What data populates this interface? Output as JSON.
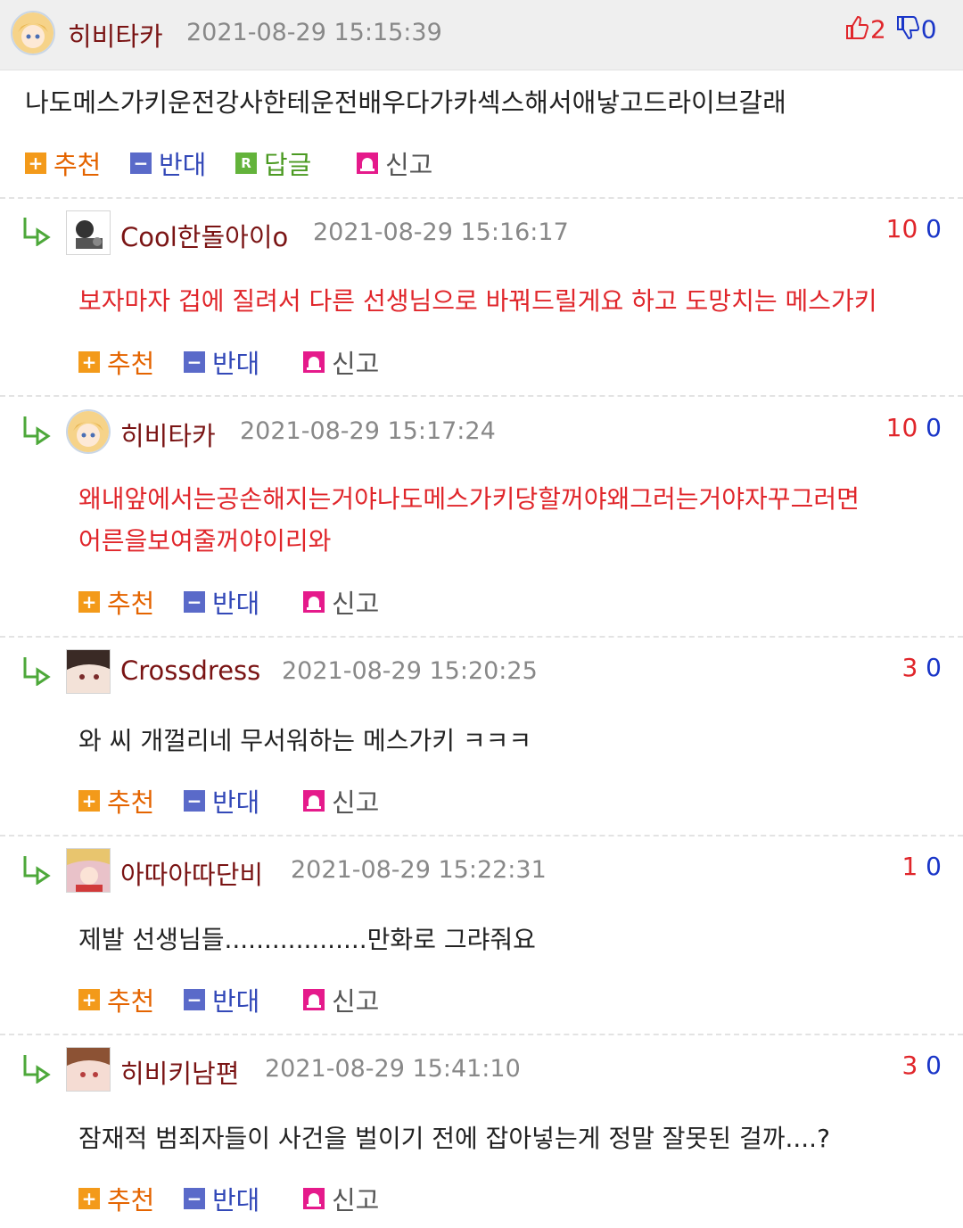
{
  "post": {
    "nick": "히비타카",
    "date": "2021-08-29 15:15:39",
    "up": "2",
    "down": "0",
    "text": "나도메스가키운전강사한테운전배우다가카섹스해서애낳고드라이브갈래",
    "actions": {
      "recommend": "추천",
      "oppose": "반대",
      "reply": "답글",
      "report": "신고"
    }
  },
  "comments": [
    {
      "nick": "Cool한돌아이o",
      "date": "2021-08-29 15:16:17",
      "up": "10",
      "down": "0",
      "lines": [
        "보자마자 겁에 질려서 다른 선생님으로 바꿔드릴게요 하고 도망치는 메스가키"
      ],
      "actions": {
        "recommend": "추천",
        "oppose": "반대",
        "report": "신고"
      }
    },
    {
      "nick": "히비타카",
      "date": "2021-08-29 15:17:24",
      "up": "10",
      "down": "0",
      "lines": [
        "왜내앞에서는공손해지는거야나도메스가키당할꺼야왜그러는거야자꾸그러면",
        "어른을보여줄꺼야이리와"
      ],
      "actions": {
        "recommend": "추천",
        "oppose": "반대",
        "report": "신고"
      }
    },
    {
      "nick": "Crossdress",
      "date": "2021-08-29 15:20:25",
      "up": "3",
      "down": "0",
      "lines": [
        "와 씨 개껄리네 무서워하는 메스가키 ㅋㅋㅋ"
      ],
      "actions": {
        "recommend": "추천",
        "oppose": "반대",
        "report": "신고"
      }
    },
    {
      "nick": "아따아따단비",
      "date": "2021-08-29 15:22:31",
      "up": "1",
      "down": "0",
      "lines": [
        "제발 선생님들..................만화로 그랴줘요"
      ],
      "actions": {
        "recommend": "추천",
        "oppose": "반대",
        "report": "신고"
      }
    },
    {
      "nick": "히비키남편",
      "date": "2021-08-29 15:41:10",
      "up": "3",
      "down": "0",
      "lines": [
        "잠재적 범죄자들이 사건을 벌이기 전에 잡아넣는게 정말 잘못된 걸까....?"
      ],
      "actions": {
        "recommend": "추천",
        "oppose": "반대",
        "report": "신고"
      }
    }
  ],
  "colors": {
    "red_text": "#e0262b",
    "nick": "#7a1414",
    "up": "#e0262b",
    "down": "#1a36c8"
  }
}
